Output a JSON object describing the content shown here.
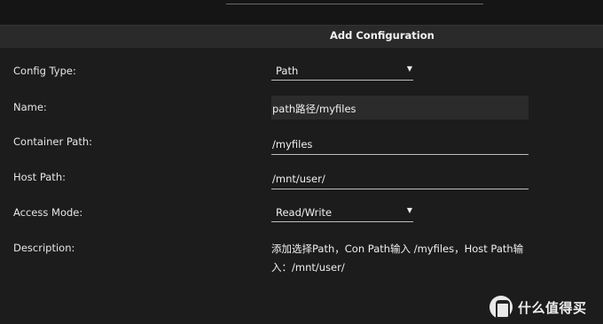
{
  "dialog": {
    "title": "Add Configuration"
  },
  "form": {
    "config_type": {
      "label": "Config Type:",
      "value": "Path"
    },
    "name": {
      "label": "Name:",
      "value": "path路径/myfiles"
    },
    "container_path": {
      "label": "Container Path:",
      "value": "/myfiles"
    },
    "host_path": {
      "label": "Host Path:",
      "value": "/mnt/user/"
    },
    "access_mode": {
      "label": "Access Mode:",
      "value": "Read/Write"
    },
    "description": {
      "label": "Description:",
      "line1": "添加选择Path，Con Path输入 /myfiles，Host Path输",
      "line2": "入：/mnt/user/"
    }
  },
  "watermark": {
    "text": "什么值得买"
  }
}
